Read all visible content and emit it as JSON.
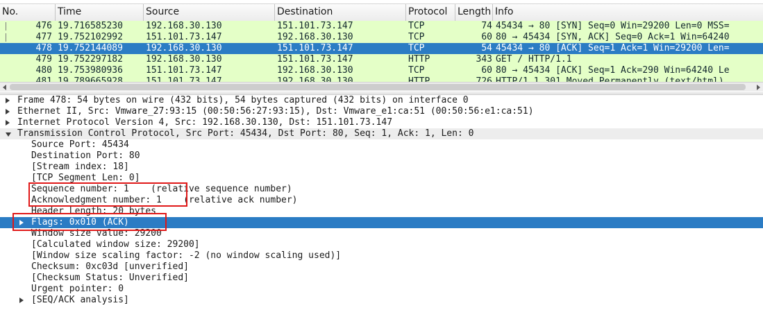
{
  "packet_list": {
    "columns": [
      "No.",
      "Time",
      "Source",
      "Destination",
      "Protocol",
      "Length",
      "Info"
    ],
    "rows": [
      {
        "no": "476",
        "time": "19.716585230",
        "source": "192.168.30.130",
        "destination": "151.101.73.147",
        "protocol": "TCP",
        "length": "74",
        "info": "45434 → 80 [SYN] Seq=0 Win=29200 Len=0 MSS=",
        "selected": false
      },
      {
        "no": "477",
        "time": "19.752102992",
        "source": "151.101.73.147",
        "destination": "192.168.30.130",
        "protocol": "TCP",
        "length": "60",
        "info": "80 → 45434 [SYN, ACK] Seq=0 Ack=1 Win=64240",
        "selected": false
      },
      {
        "no": "478",
        "time": "19.752144089",
        "source": "192.168.30.130",
        "destination": "151.101.73.147",
        "protocol": "TCP",
        "length": "54",
        "info": "45434 → 80 [ACK] Seq=1 Ack=1 Win=29200 Len=",
        "selected": true
      },
      {
        "no": "479",
        "time": "19.752297182",
        "source": "192.168.30.130",
        "destination": "151.101.73.147",
        "protocol": "HTTP",
        "length": "343",
        "info": "GET / HTTP/1.1",
        "selected": false
      },
      {
        "no": "480",
        "time": "19.753980936",
        "source": "151.101.73.147",
        "destination": "192.168.30.130",
        "protocol": "TCP",
        "length": "60",
        "info": "80 → 45434 [ACK] Seq=1 Ack=290 Win=64240 Le",
        "selected": false
      },
      {
        "no": "481",
        "time": "19.789665928",
        "source": "151.101.73.147",
        "destination": "192.168.30.130",
        "protocol": "HTTP",
        "length": "726",
        "info": "HTTP/1.1 301 Moved Permanently  (text/html)",
        "selected": false
      }
    ]
  },
  "details": {
    "lines": [
      {
        "text": "Frame 478: 54 bytes on wire (432 bits), 54 bytes captured (432 bits) on interface 0",
        "level": 0,
        "expander": "collapsed",
        "selected": false,
        "shaded": false
      },
      {
        "text": "Ethernet II, Src: Vmware_27:93:15 (00:50:56:27:93:15), Dst: Vmware_e1:ca:51 (00:50:56:e1:ca:51)",
        "level": 0,
        "expander": "collapsed",
        "selected": false,
        "shaded": false
      },
      {
        "text": "Internet Protocol Version 4, Src: 192.168.30.130, Dst: 151.101.73.147",
        "level": 0,
        "expander": "collapsed",
        "selected": false,
        "shaded": false
      },
      {
        "text": "Transmission Control Protocol, Src Port: 45434, Dst Port: 80, Seq: 1, Ack: 1, Len: 0",
        "level": 0,
        "expander": "expanded",
        "selected": false,
        "shaded": true
      },
      {
        "text": "Source Port: 45434",
        "level": 1,
        "expander": "none",
        "selected": false,
        "shaded": false
      },
      {
        "text": "Destination Port: 80",
        "level": 1,
        "expander": "none",
        "selected": false,
        "shaded": false
      },
      {
        "text": "[Stream index: 18]",
        "level": 1,
        "expander": "none",
        "selected": false,
        "shaded": false
      },
      {
        "text": "[TCP Segment Len: 0]",
        "level": 1,
        "expander": "none",
        "selected": false,
        "shaded": false
      },
      {
        "text": "Sequence number: 1    (relative sequence number)",
        "level": 1,
        "expander": "none",
        "selected": false,
        "shaded": false
      },
      {
        "text": "Acknowledgment number: 1    (relative ack number)",
        "level": 1,
        "expander": "none",
        "selected": false,
        "shaded": false
      },
      {
        "text": "Header Length: 20 bytes",
        "level": 1,
        "expander": "none",
        "selected": false,
        "shaded": false
      },
      {
        "text": "Flags: 0x010 (ACK)",
        "level": 1,
        "expander": "collapsed",
        "selected": true,
        "shaded": false
      },
      {
        "text": "Window size value: 29200",
        "level": 1,
        "expander": "none",
        "selected": false,
        "shaded": false
      },
      {
        "text": "[Calculated window size: 29200]",
        "level": 1,
        "expander": "none",
        "selected": false,
        "shaded": false
      },
      {
        "text": "[Window size scaling factor: -2 (no window scaling used)]",
        "level": 1,
        "expander": "none",
        "selected": false,
        "shaded": false
      },
      {
        "text": "Checksum: 0xc03d [unverified]",
        "level": 1,
        "expander": "none",
        "selected": false,
        "shaded": false
      },
      {
        "text": "[Checksum Status: Unverified]",
        "level": 1,
        "expander": "none",
        "selected": false,
        "shaded": false
      },
      {
        "text": "Urgent pointer: 0",
        "level": 1,
        "expander": "none",
        "selected": false,
        "shaded": false
      },
      {
        "text": "[SEQ/ACK analysis]",
        "level": 1,
        "expander": "collapsed",
        "selected": false,
        "shaded": false
      }
    ]
  },
  "colors": {
    "tcp_row": "#e4ffc7",
    "selection": "#2b7cc4",
    "highlight_box": "#e01818"
  }
}
